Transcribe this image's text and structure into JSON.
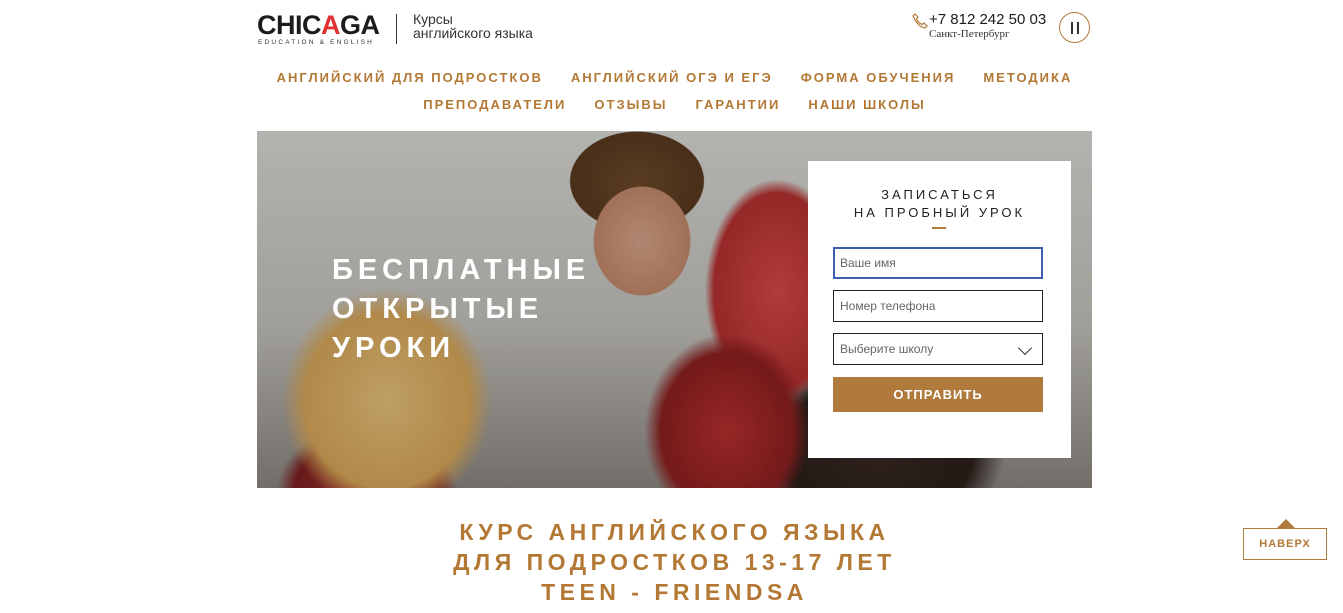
{
  "header": {
    "logo_word_1": "CHIC",
    "logo_word_a": "A",
    "logo_word_2": "GA",
    "logo_sub": "EDUCATION & ENGLISH",
    "tagline_line1": "Курсы",
    "tagline_line2": "английского языка",
    "phone": "+7 812 242 50 03",
    "city": "Санкт-Петербург",
    "icons": {
      "phone": "phone-icon",
      "pause": "pause-icon"
    }
  },
  "nav": {
    "row1": [
      "Английский для подростков",
      "Английский ОГЭ и ЕГЭ",
      "Форма обучения",
      "Методика"
    ],
    "row2": [
      "Преподаватели",
      "Отзывы",
      "Гарантии",
      "Наши школы"
    ]
  },
  "hero": {
    "title_lines": [
      "Бесплатные",
      "открытые",
      "уроки"
    ]
  },
  "form": {
    "title_line1": "Записаться",
    "title_line2": "на пробный урок",
    "name_placeholder": "Ваше имя",
    "phone_placeholder": "Номер телефона",
    "school_select": "Выберите школу",
    "submit_label": "Отправить"
  },
  "course": {
    "lines": [
      "Курс английского языка",
      "для подростков 13-17 лет",
      "Teen - FriendsA"
    ]
  },
  "to_top": {
    "label": "НАВЕРХ"
  },
  "colors": {
    "accent": "#b27834",
    "focus": "#3c5fb4",
    "logo_red": "#e03030"
  }
}
